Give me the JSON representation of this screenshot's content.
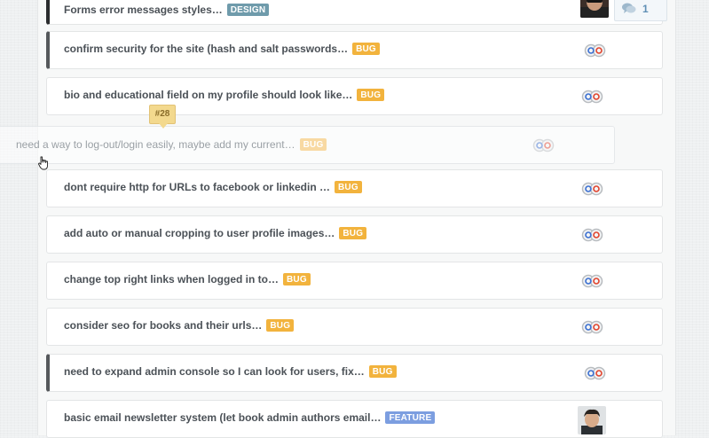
{
  "tasks": [
    {
      "title": "Forms error messages styles…",
      "tag": "DESIGN",
      "tag_kind": "design",
      "has_photo": true,
      "comments": "1"
    },
    {
      "title": "confirm security for the site (hash and salt passwords…",
      "tag": "BUG",
      "tag_kind": "bug"
    },
    {
      "title": "bio and educational field on my profile should look like…",
      "tag": "BUG",
      "tag_kind": "bug"
    },
    {
      "title": "dont require http for URLs to facebook or linkedin …",
      "tag": "BUG",
      "tag_kind": "bug"
    },
    {
      "title": "add auto or manual cropping to user profile images…",
      "tag": "BUG",
      "tag_kind": "bug"
    },
    {
      "title": "change top right links when logged in to…",
      "tag": "BUG",
      "tag_kind": "bug"
    },
    {
      "title": "consider seo for books and their urls…",
      "tag": "BUG",
      "tag_kind": "bug"
    },
    {
      "title": "need to expand admin console so I can look for users, fix…",
      "tag": "BUG",
      "tag_kind": "bug"
    },
    {
      "title": "basic email newsletter system (let book admin authors email…",
      "tag": "FEATURE",
      "tag_kind": "feature",
      "has_photo": true
    }
  ],
  "dragging": {
    "title": "need a way to log-out/login easily, maybe add my current…",
    "tag": "BUG",
    "tooltip": "#28"
  },
  "colors": {
    "bug": "#f2b33d",
    "design": "#6f9bab",
    "feature": "#7c9ee0",
    "marker": "#55585b"
  },
  "icons": {
    "assignee": "assignee-chain-icon",
    "comments": "speech-bubble-icon",
    "cursor": "hand-pointer-icon"
  }
}
